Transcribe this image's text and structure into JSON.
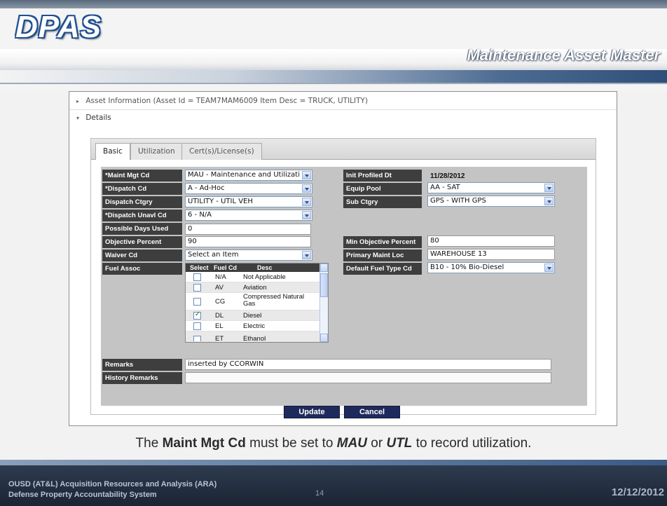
{
  "slide": {
    "logo_text": "DPAS",
    "title": "Maintenance Asset Master",
    "caption_prefix": "The ",
    "caption_bold1": "Maint Mgt Cd",
    "caption_mid1": " must be set to ",
    "caption_em1": "MAU",
    "caption_mid2": " or ",
    "caption_em2": "UTL",
    "caption_suffix": " to record utilization.",
    "footer_line1": "OUSD (AT&L) Acquisition Resources and Analysis (ARA)",
    "footer_line2": "Defense Property Accountability System",
    "page_number": "14",
    "date": "12/12/2012"
  },
  "panel": {
    "asset_info_label": "Asset Information (Asset Id = TEAM7MAM6009 Item Desc = TRUCK, UTILITY)",
    "details_label": "Details"
  },
  "tabs": [
    {
      "label": "Basic",
      "active": true
    },
    {
      "label": "Utilization",
      "active": false
    },
    {
      "label": "Cert(s)/License(s)",
      "active": false
    }
  ],
  "form": {
    "maint_mgt_cd": {
      "label": "*Maint Mgt Cd",
      "value": "MAU - Maintenance and Utilizati"
    },
    "dispatch_cd": {
      "label": "*Dispatch Cd",
      "value": "A - Ad-Hoc"
    },
    "dispatch_ctgry": {
      "label": "Dispatch Ctgry",
      "value": "UTILITY - UTIL VEH"
    },
    "dispatch_unavl_cd": {
      "label": "*Dispatch Unavl Cd",
      "value": "6 - N/A"
    },
    "possible_days_used": {
      "label": "Possible Days Used",
      "value": "0"
    },
    "objective_percent": {
      "label": "Objective Percent",
      "value": "90"
    },
    "waiver_cd": {
      "label": "Waiver Cd",
      "value": "Select an Item"
    },
    "fuel_assoc": {
      "label": "Fuel Assoc"
    },
    "remarks": {
      "label": "Remarks",
      "value": "inserted by CCORWIN"
    },
    "history_remarks": {
      "label": "History Remarks",
      "value": ""
    },
    "init_profiled_dt": {
      "label": "Init Profiled Dt",
      "value": "11/28/2012"
    },
    "equip_pool": {
      "label": "Equip Pool",
      "value": "AA - SAT"
    },
    "sub_ctgry": {
      "label": "Sub Ctgry",
      "value": "GPS - WITH GPS"
    },
    "min_objective_percent": {
      "label": "Min Objective Percent",
      "value": "80"
    },
    "primary_maint_loc": {
      "label": "Primary Maint Loc",
      "value": "WAREHOUSE 13"
    },
    "default_fuel_type_cd": {
      "label": "Default Fuel Type Cd",
      "value": "B10 - 10% Bio-Diesel"
    }
  },
  "fuel_grid": {
    "headers": {
      "select": "Select",
      "fuel_cd": "Fuel Cd",
      "desc": "Desc"
    },
    "rows": [
      {
        "code": "N/A",
        "desc": "Not Applicable",
        "checked": false
      },
      {
        "code": "AV",
        "desc": "Aviation",
        "checked": false
      },
      {
        "code": "CG",
        "desc": "Compressed Natural Gas",
        "checked": false
      },
      {
        "code": "DL",
        "desc": "Diesel",
        "checked": true
      },
      {
        "code": "EL",
        "desc": "Electric",
        "checked": false
      },
      {
        "code": "ET",
        "desc": "Ethanol",
        "checked": false
      }
    ]
  },
  "buttons": {
    "update": "Update",
    "cancel": "Cancel"
  }
}
